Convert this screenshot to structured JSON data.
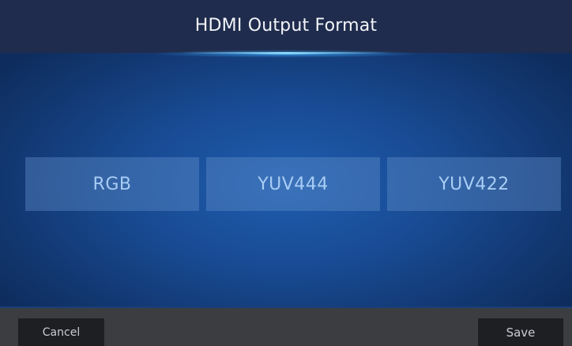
{
  "header": {
    "title": "HDMI Output Format"
  },
  "options": [
    {
      "label": "RGB"
    },
    {
      "label": "YUV444"
    },
    {
      "label": "YUV422"
    }
  ],
  "footer": {
    "cancel_label": "Cancel",
    "save_label": "Save"
  },
  "colors": {
    "header_bg": "#1f2c4d",
    "content_bg": "#184a92",
    "option_text": "#a8cdf5",
    "footer_bg": "#3b3d41",
    "button_bg": "#1e1f22",
    "accent_glow": "#96e1ff"
  }
}
